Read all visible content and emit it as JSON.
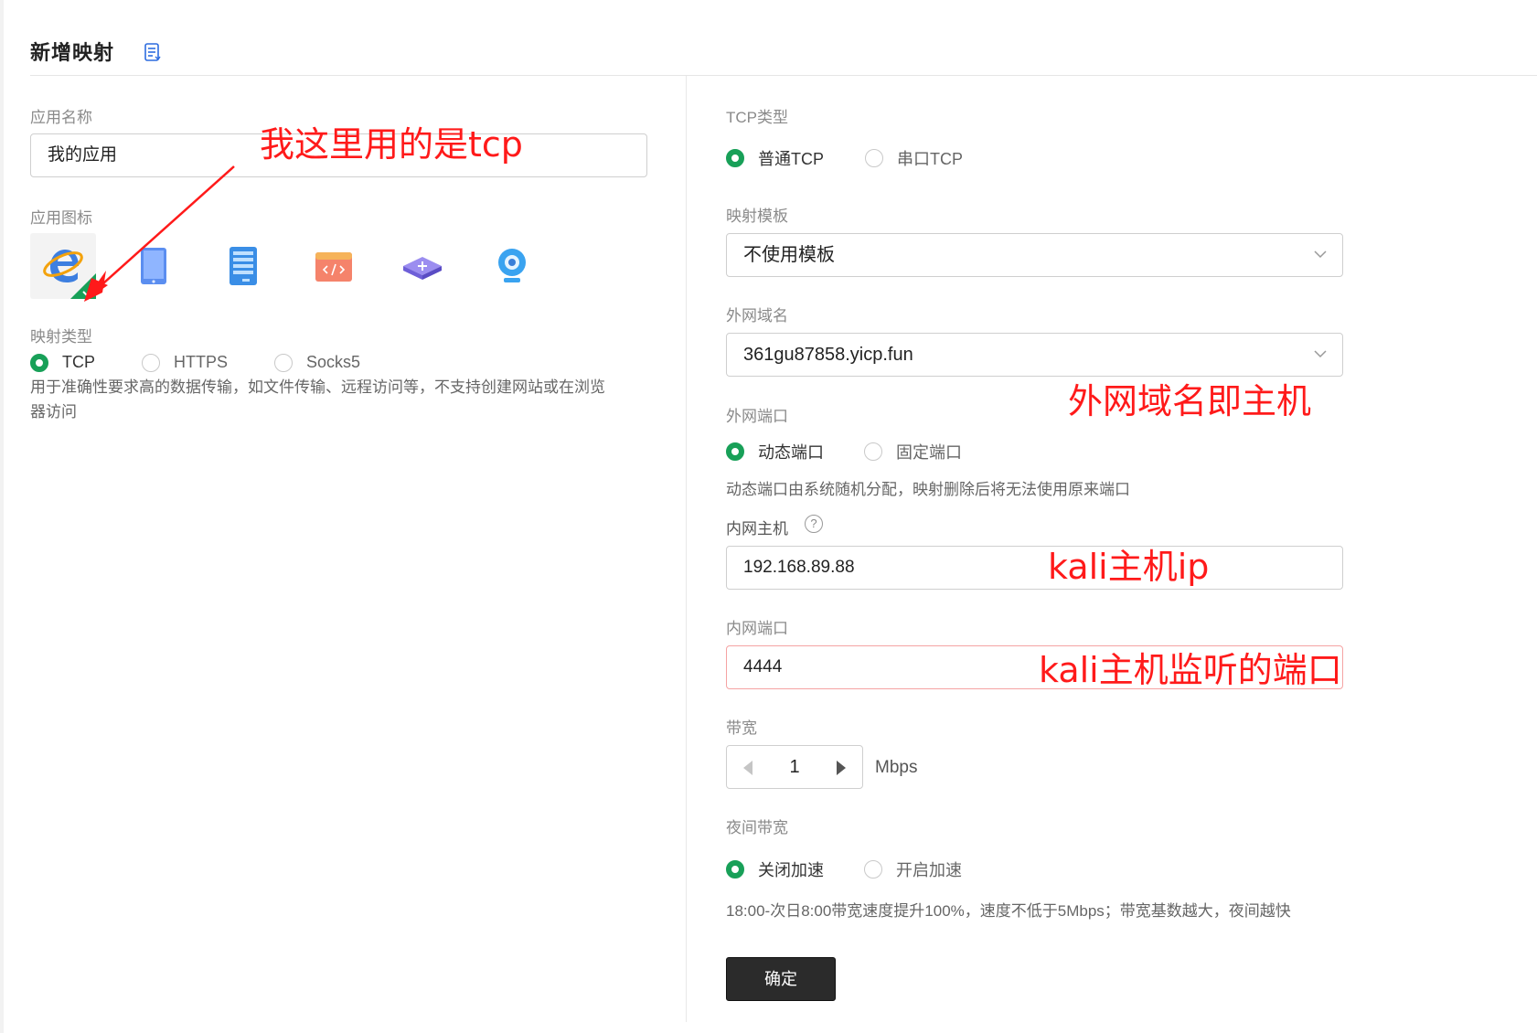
{
  "header": {
    "title": "新增映射",
    "doc_icon": "document-icon"
  },
  "left": {
    "app_name_label": "应用名称",
    "app_name_value": "我的应用",
    "app_icon_label": "应用图标",
    "app_icons": [
      "ie-browser-icon",
      "tablet-icon",
      "server-icon",
      "code-window-icon",
      "router-icon",
      "webcam-icon"
    ],
    "map_type_label": "映射类型",
    "map_types": [
      {
        "label": "TCP",
        "selected": true
      },
      {
        "label": "HTTPS",
        "selected": false
      },
      {
        "label": "Socks5",
        "selected": false
      }
    ],
    "map_type_desc_line1": "用于准确性要求高的数据传输，如文件传输、远程访问等，不支持创建网站或在浏览",
    "map_type_desc_line2": "器访问"
  },
  "right": {
    "tcp_type_label": "TCP类型",
    "tcp_types": [
      {
        "label": "普通TCP",
        "selected": true
      },
      {
        "label": "串口TCP",
        "selected": false
      }
    ],
    "template_label": "映射模板",
    "template_value": "不使用模板",
    "domain_label": "外网域名",
    "domain_value": "361gu87858.yicp.fun",
    "ext_port_label": "外网端口",
    "ext_ports": [
      {
        "label": "动态端口",
        "selected": true
      },
      {
        "label": "固定端口",
        "selected": false
      }
    ],
    "ext_port_desc": "动态端口由系统随机分配，映射删除后将无法使用原来端口",
    "int_host_label": "内网主机",
    "int_host_help": "?",
    "int_host_value": "192.168.89.88",
    "int_port_label": "内网端口",
    "int_port_value": "4444",
    "bandwidth_label": "带宽",
    "bandwidth_value": "1",
    "bandwidth_unit": "Mbps",
    "night_label": "夜间带宽",
    "night_options": [
      {
        "label": "关闭加速",
        "selected": true
      },
      {
        "label": "开启加速",
        "selected": false
      }
    ],
    "night_desc": "18:00-次日8:00带宽速度提升100%，速度不低于5Mbps；带宽基数越大，夜间越快",
    "confirm_label": "确定"
  },
  "annotations": {
    "tcp_note": "我这里用的是tcp",
    "domain_note": "外网域名即主机",
    "host_note": "kali主机ip",
    "port_note": "kali主机监听的端口"
  },
  "colors": {
    "accent": "#18a058",
    "annotation": "#ff1a1a",
    "button": "#2b2b2b"
  }
}
